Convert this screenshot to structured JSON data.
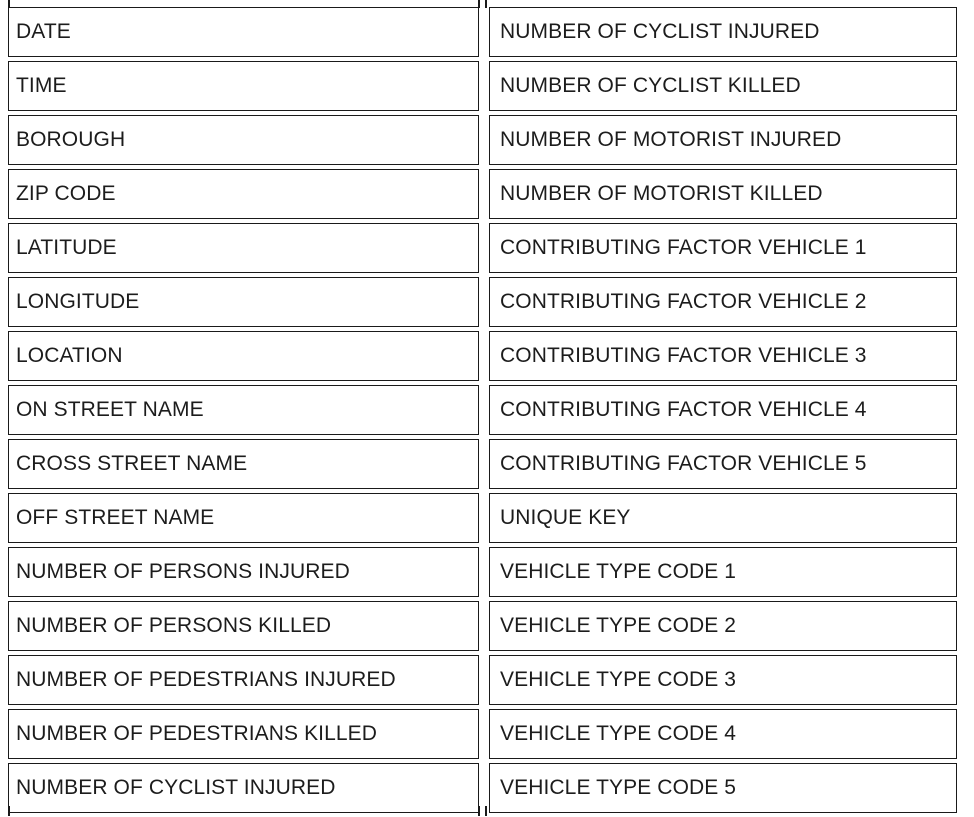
{
  "table": {
    "left_column": [
      "DATE",
      "TIME",
      "BOROUGH",
      "ZIP CODE",
      "LATITUDE",
      "LONGITUDE",
      "LOCATION",
      "ON STREET NAME",
      "CROSS STREET NAME",
      "OFF STREET NAME",
      "NUMBER OF PERSONS INJURED",
      "NUMBER OF PERSONS KILLED",
      "NUMBER OF PEDESTRIANS INJURED",
      "NUMBER OF PEDESTRIANS KILLED",
      "NUMBER OF CYCLIST INJURED"
    ],
    "right_column": [
      "NUMBER OF CYCLIST INJURED",
      "NUMBER OF CYCLIST KILLED",
      "NUMBER OF MOTORIST INJURED",
      "NUMBER OF MOTORIST KILLED",
      "CONTRIBUTING FACTOR VEHICLE 1",
      "CONTRIBUTING FACTOR VEHICLE 2",
      "CONTRIBUTING FACTOR VEHICLE 3",
      "CONTRIBUTING FACTOR VEHICLE 4",
      "CONTRIBUTING FACTOR VEHICLE 5",
      "UNIQUE KEY",
      "VEHICLE TYPE CODE 1",
      "VEHICLE TYPE CODE 2",
      "VEHICLE TYPE CODE 3",
      "VEHICLE TYPE CODE 4",
      "VEHICLE TYPE CODE 5"
    ]
  }
}
